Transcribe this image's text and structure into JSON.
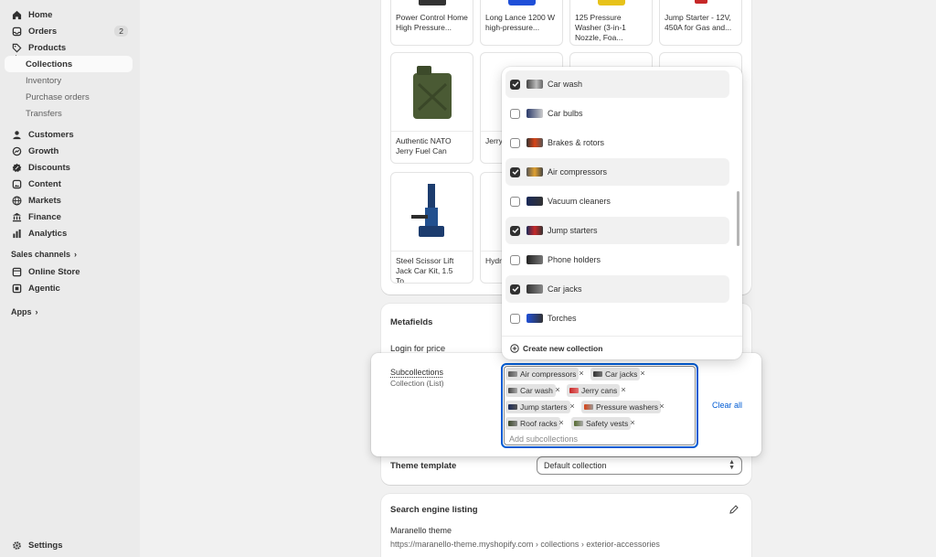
{
  "sidebar": {
    "items": [
      {
        "label": "Home",
        "icon": "home-icon"
      },
      {
        "label": "Orders",
        "icon": "orders-icon",
        "badge": "2"
      },
      {
        "label": "Products",
        "icon": "tag-icon"
      },
      {
        "label": "Collections"
      },
      {
        "label": "Inventory"
      },
      {
        "label": "Purchase orders"
      },
      {
        "label": "Transfers"
      },
      {
        "label": "Customers",
        "icon": "person-icon"
      },
      {
        "label": "Growth",
        "icon": "growth-icon"
      },
      {
        "label": "Discounts",
        "icon": "discount-icon"
      },
      {
        "label": "Content",
        "icon": "content-icon"
      },
      {
        "label": "Markets",
        "icon": "globe-icon"
      },
      {
        "label": "Finance",
        "icon": "bank-icon"
      },
      {
        "label": "Analytics",
        "icon": "chart-icon"
      }
    ],
    "sales_channels": "Sales channels",
    "channels": [
      {
        "label": "Online Store",
        "icon": "store-icon"
      },
      {
        "label": "Agentic",
        "icon": "agentic-icon"
      }
    ],
    "apps": "Apps",
    "settings": "Settings"
  },
  "products_top": [
    "Power Control Home High Pressure...",
    "Long Lance 1200 W high-pressure...",
    "125 Pressure Washer (3-in-1 Nozzle, Foa...",
    "Jump Starter - 12V, 450A for Gas and..."
  ],
  "products_mid": [
    "Authentic NATO Jerry Fuel Can",
    "Jerry Milita"
  ],
  "products_bot": [
    "Steel Scissor Lift Jack Car Kit, 1.5 To...",
    "Hydr Bottl"
  ],
  "metafields": {
    "title": "Metafields",
    "login_label": "Login for price",
    "subcollections_label": "Subcollections",
    "subcollections_type": "Collection (List)",
    "clear_all": "Clear all",
    "placeholder": "Add subcollections",
    "tags": [
      "Air compressors",
      "Car jacks",
      "Car wash",
      "Jerry cans",
      "Jump starters",
      "Pressure washers",
      "Roof racks",
      "Safety vests"
    ],
    "theme_label": "Theme template",
    "theme_value": "Default collection"
  },
  "dropdown": {
    "options": [
      {
        "label": "Car wash",
        "checked": true
      },
      {
        "label": "Car bulbs",
        "checked": false
      },
      {
        "label": "Brakes & rotors",
        "checked": false
      },
      {
        "label": "Air compressors",
        "checked": true
      },
      {
        "label": "Vacuum cleaners",
        "checked": false
      },
      {
        "label": "Jump starters",
        "checked": true
      },
      {
        "label": "Phone holders",
        "checked": false
      },
      {
        "label": "Car jacks",
        "checked": true
      },
      {
        "label": "Torches",
        "checked": false
      }
    ],
    "create": "Create new collection"
  },
  "seo": {
    "title": "Search engine listing",
    "site": "Maranello theme",
    "url": "https://maranello-theme.myshopify.com › collections › exterior-accessories"
  },
  "colors": {
    "accent": "#005bd3",
    "sidebar_bg": "#ebebeb",
    "page_bg": "#f1f1f1"
  }
}
